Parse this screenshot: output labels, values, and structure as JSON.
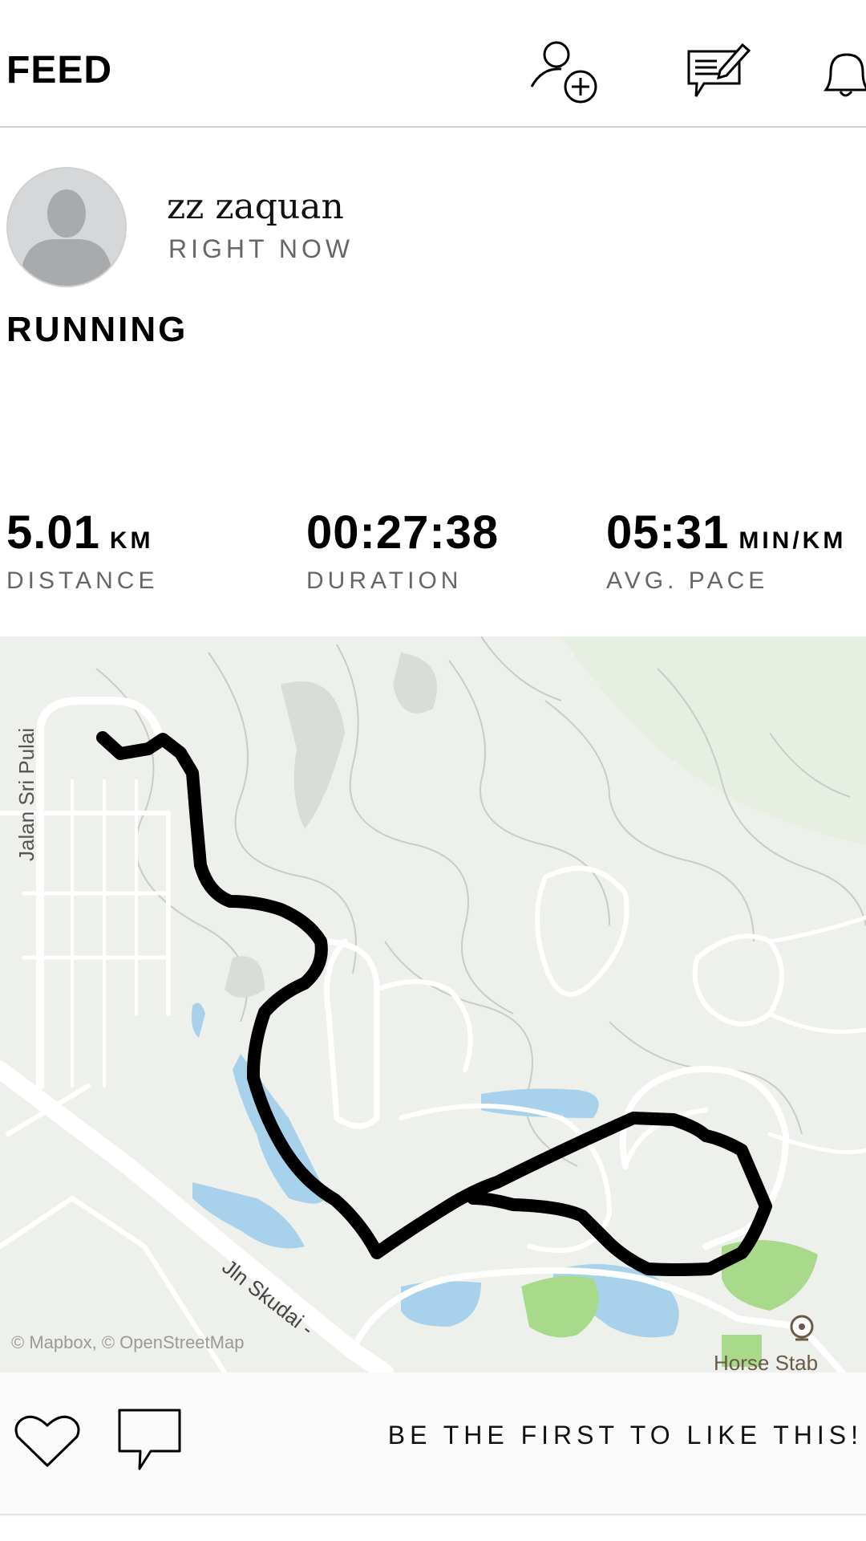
{
  "header": {
    "title": "FEED",
    "icons": [
      "add-friend-icon",
      "compose-post-icon",
      "notifications-bell-icon"
    ]
  },
  "post": {
    "user_name": "zz zaquan",
    "timestamp": "RIGHT NOW",
    "activity_type": "RUNNING",
    "stats": [
      {
        "value": "5.01",
        "unit": "KM",
        "label": "DISTANCE"
      },
      {
        "value": "00:27:38",
        "unit": "",
        "label": "DURATION"
      },
      {
        "value": "05:31",
        "unit": "MIN/KM",
        "label": "AVG. PACE"
      }
    ]
  },
  "map": {
    "attribution": "© Mapbox, © OpenStreetMap",
    "street_labels": [
      "Jalan Sri Pulai",
      "Jln Skudai -"
    ],
    "place_label": "Horse Stab",
    "route_color": "#000000",
    "land_color": "#eef0ec",
    "road_color": "#ffffff",
    "water_color": "#a8d2ec",
    "park_color": "#a9d98a"
  },
  "footer": {
    "likes_text": "BE THE FIRST TO LIKE THIS!",
    "icons": [
      "heart-icon",
      "comment-icon"
    ]
  }
}
